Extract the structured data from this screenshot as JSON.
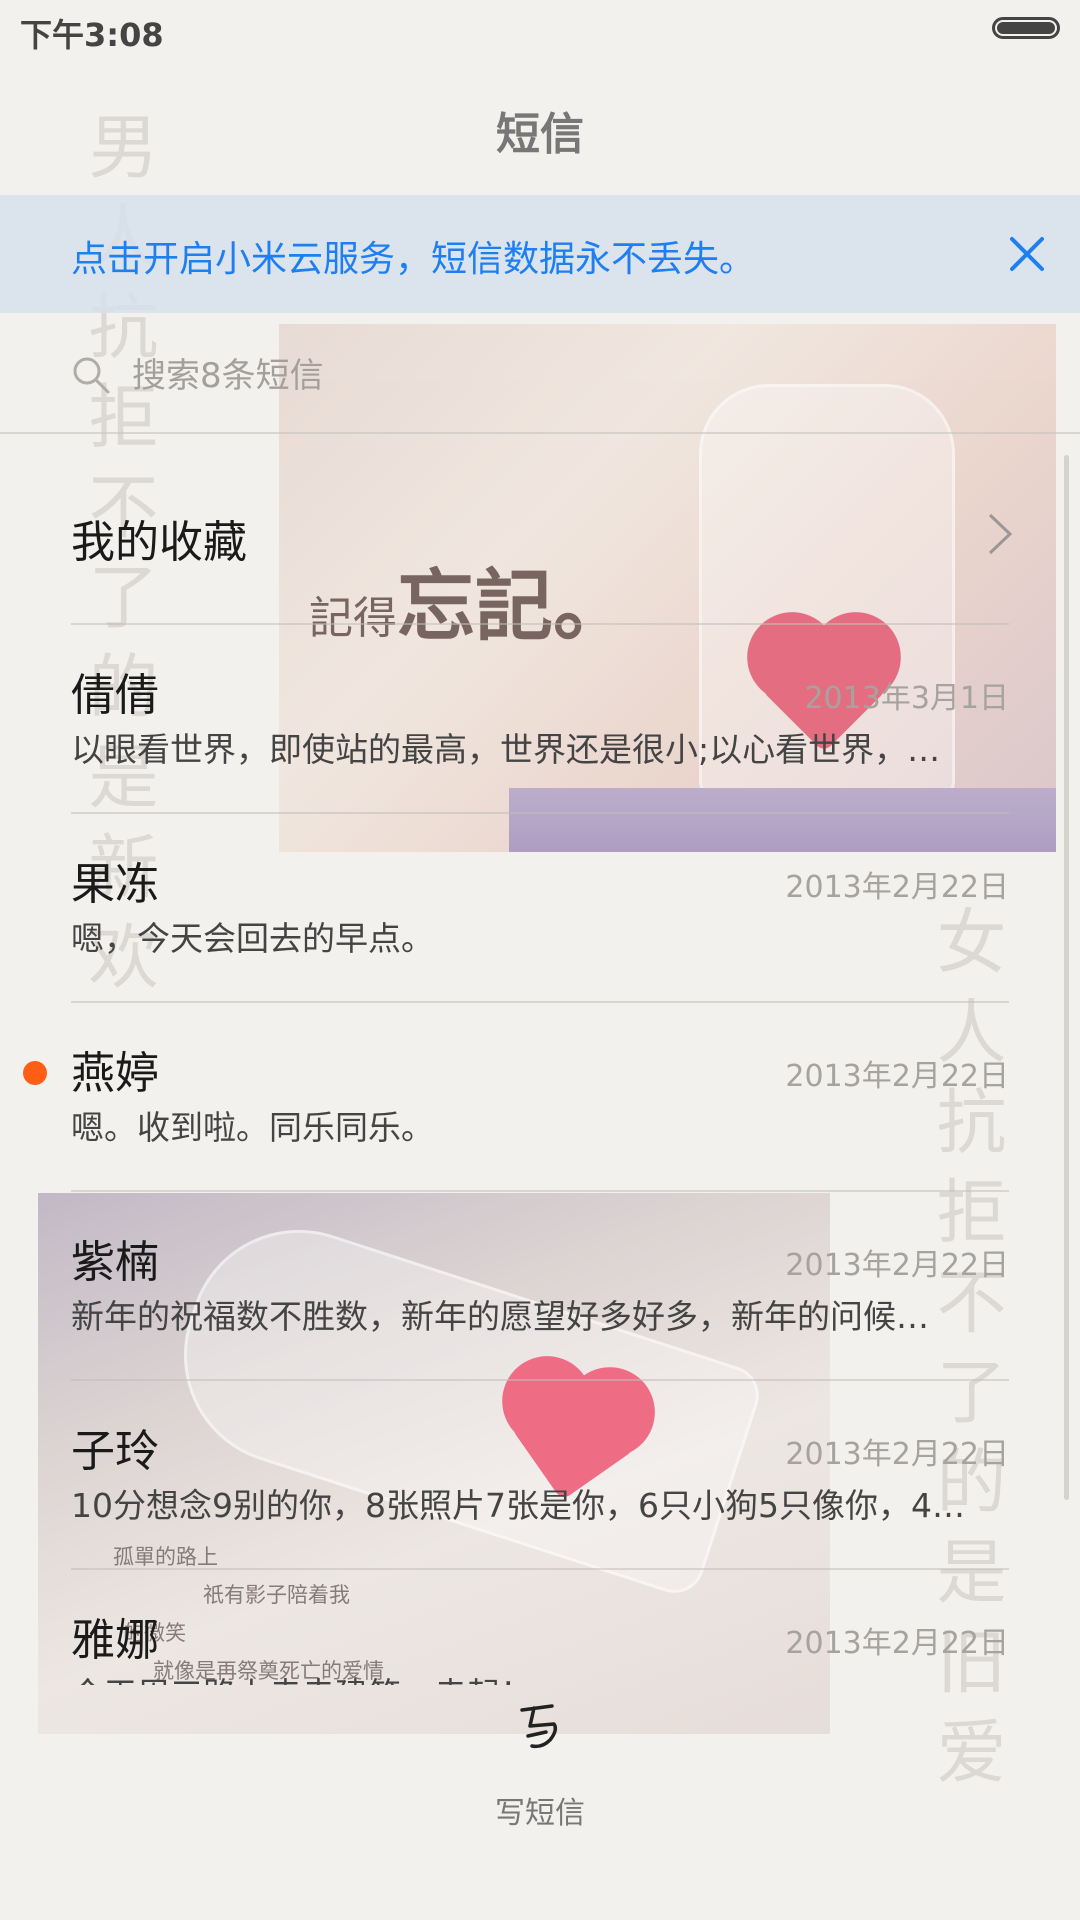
{
  "status_bar": {
    "time": "下午3:08"
  },
  "header": {
    "title": "短信"
  },
  "banner": {
    "text": "点击开启小米云服务，短信数据永不丢失。"
  },
  "search": {
    "placeholder": "搜索8条短信"
  },
  "favorites": {
    "label": "我的收藏"
  },
  "conversations": [
    {
      "name": "倩倩",
      "date": "2013年3月1日",
      "preview": "以眼看世界，即使站的最高，世界还是很小;以心看世界，…",
      "unread": false
    },
    {
      "name": "果冻",
      "date": "2013年2月22日",
      "preview": "嗯，今天会回去的早点。",
      "unread": false
    },
    {
      "name": "燕婷",
      "date": "2013年2月22日",
      "preview": "嗯。收到啦。同乐同乐。",
      "unread": true
    },
    {
      "name": "紫楠",
      "date": "2013年2月22日",
      "preview": "新年的祝福数不胜数，新年的愿望好多好多，新年的问候…",
      "unread": false
    },
    {
      "name": "子玲",
      "date": "2013年2月22日",
      "preview": "10分想念9别的你，8张照片7张是你，6只小狗5只像你，4…",
      "unread": false
    },
    {
      "name": "雅娜",
      "date": "2013年2月22日",
      "preview": "今天周三路上走走建筑，走起！",
      "unread": false
    }
  ],
  "compose": {
    "label": "写短信"
  },
  "decor": {
    "poem_left": "男人抗拒不了的是新欢",
    "poem_right": "女人抗拒不了的是旧爱",
    "photo_top_brand_small": "記得",
    "photo_top_brand_large": "忘記。",
    "photo_bottom_caption": [
      "孤單的路上",
      "祇有影子陪着我",
      "的微笑",
      "就像是再祭奠死亡的爱情"
    ]
  },
  "colors": {
    "accent": "#1e7ff0",
    "unread_dot": "#ff5e14"
  },
  "icons": [
    "battery-icon",
    "close-icon",
    "search-icon",
    "chevron-right-icon",
    "compose-icon"
  ]
}
